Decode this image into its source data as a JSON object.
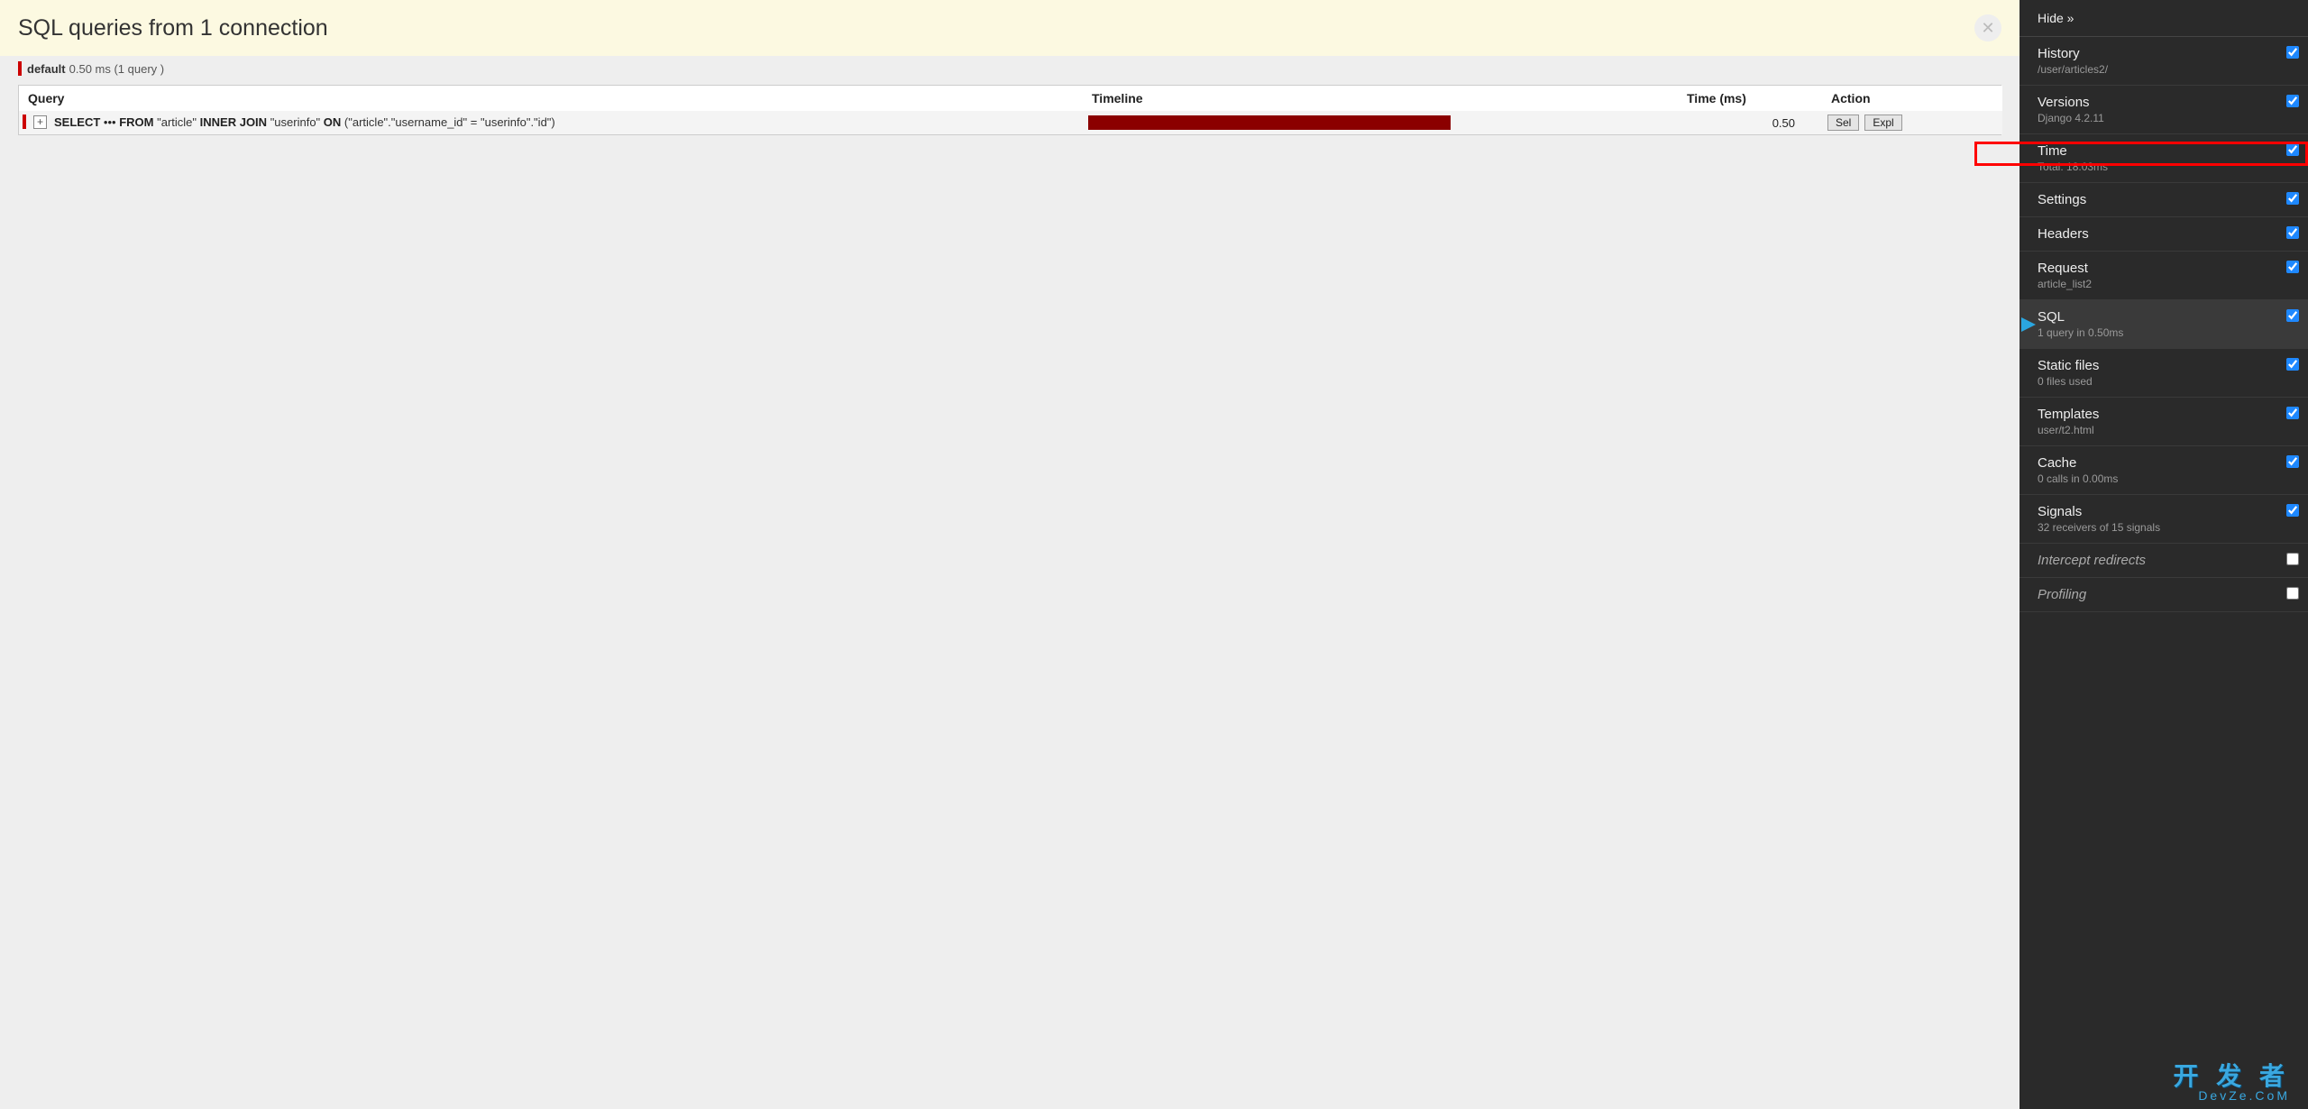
{
  "header": {
    "title": "SQL queries from 1 connection"
  },
  "subheader": {
    "db_name": "default",
    "stats": "0.50 ms (1 query )"
  },
  "table": {
    "headers": {
      "query": "Query",
      "timeline": "Timeline",
      "time": "Time (ms)",
      "action": "Action"
    },
    "row0": {
      "expand_glyph": "+",
      "kw_select": "SELECT",
      "dots": "•••",
      "kw_from": "FROM",
      "tbl_article": "\"article\"",
      "kw_inner_join": "INNER JOIN",
      "tbl_userinfo": "\"userinfo\"",
      "kw_on": "ON",
      "cond": "(\"article\".\"username_id\" = \"userinfo\".\"id\")",
      "time_ms": "0.50",
      "btn_sel": "Sel",
      "btn_expl": "Expl",
      "timeline_pct": "62%"
    }
  },
  "sidebar": {
    "hide": "Hide »",
    "panels": [
      {
        "title": "History",
        "sub": "/user/articles2/",
        "checked": true
      },
      {
        "title": "Versions",
        "sub": "Django 4.2.11",
        "checked": true
      },
      {
        "title": "Time",
        "sub": "Total: 18.03ms",
        "checked": true
      },
      {
        "title": "Settings",
        "sub": "",
        "checked": true
      },
      {
        "title": "Headers",
        "sub": "",
        "checked": true
      },
      {
        "title": "Request",
        "sub": "article_list2",
        "checked": true
      },
      {
        "title": "SQL",
        "sub": "1 query in 0.50ms",
        "checked": true,
        "active": true
      },
      {
        "title": "Static files",
        "sub": "0 files used",
        "checked": true
      },
      {
        "title": "Templates",
        "sub": "user/t2.html",
        "checked": true
      },
      {
        "title": "Cache",
        "sub": "0 calls in 0.00ms",
        "checked": true
      },
      {
        "title": "Signals",
        "sub": "32 receivers of 15 signals",
        "checked": true
      },
      {
        "title": "Intercept redirects",
        "sub": "",
        "checked": false,
        "italic": true
      },
      {
        "title": "Profiling",
        "sub": "",
        "checked": false,
        "italic": true
      }
    ]
  },
  "watermark": {
    "line1": "开 发 者",
    "line2": "DevZe.CoM"
  }
}
